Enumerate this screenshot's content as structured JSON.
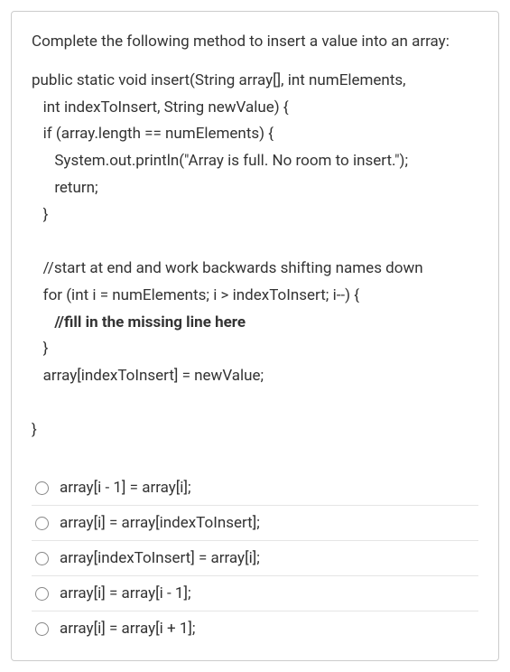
{
  "prompt": "Complete the following method to insert a value into an array:",
  "code": {
    "l1": "public static void insert(String array[], int numElements,",
    "l2": "   int indexToInsert, String newValue) {",
    "l3": "   if (array.length == numElements) {",
    "l4": "      System.out.println(\"Array is full. No room to insert.\");",
    "l5": "      return;",
    "l6": "   }",
    "l7": "",
    "l8": "   //start at end and work backwards shifting names down",
    "l9": "   for (int i = numElements; i > indexToInsert; i--) {",
    "l10": "      //fill in the missing line here",
    "l11": "   }",
    "l12": "   array[indexToInsert] = newValue;",
    "l13": "",
    "l14": "}"
  },
  "options": [
    "array[i - 1] = array[i];",
    "array[i] = array[indexToInsert];",
    "array[indexToInsert] = array[i];",
    "array[i] = array[i - 1];",
    "array[i] = array[i + 1];"
  ]
}
